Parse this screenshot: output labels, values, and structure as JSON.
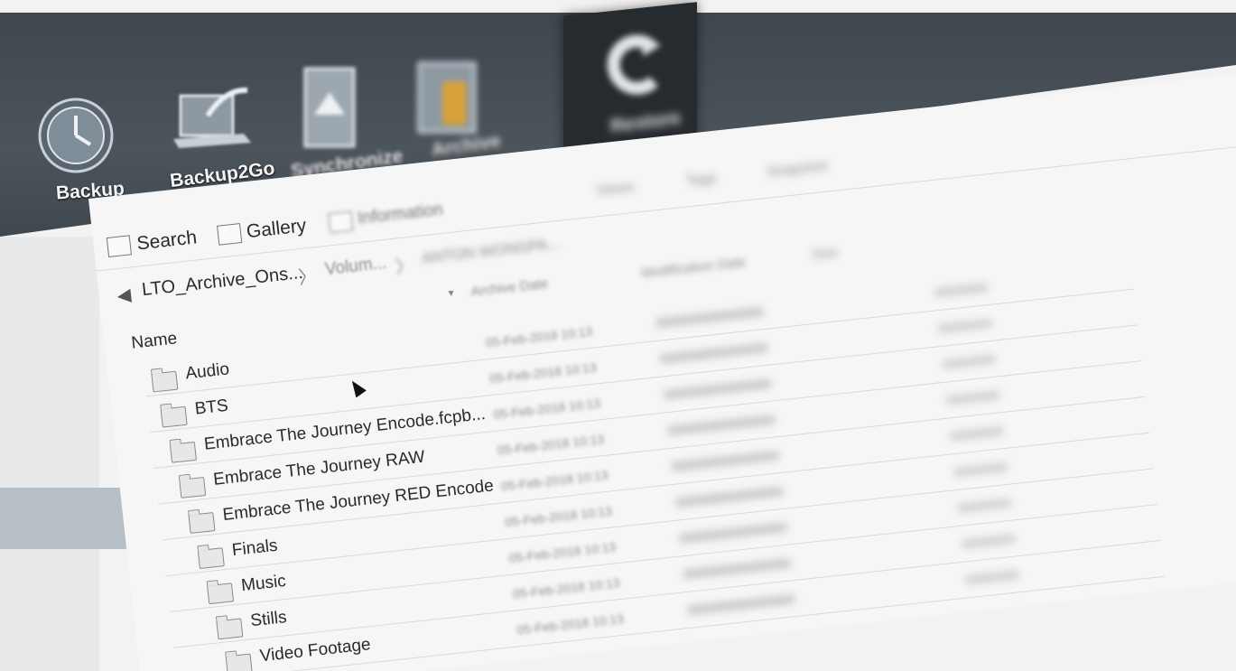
{
  "toolbar": {
    "buttons": [
      {
        "label": "Backup",
        "icon": "clock-icon"
      },
      {
        "label": "Backup2Go",
        "icon": "laptop-icon"
      },
      {
        "label": "Synchronize",
        "icon": "sync-icon"
      },
      {
        "label": "Archive",
        "icon": "archive-box-icon"
      },
      {
        "label": "Restore",
        "icon": "restore-arrow-icon"
      }
    ]
  },
  "tabs": [
    {
      "label": "Search",
      "icon": "search-icon"
    },
    {
      "label": "Gallery",
      "icon": "gallery-icon"
    },
    {
      "label": "Information",
      "icon": "information-icon"
    }
  ],
  "breadcrumb": {
    "items": [
      "LTO_Archive_Ons...",
      "Volum...",
      "ANTON WONGPA..."
    ]
  },
  "columns": {
    "name": "Name",
    "archive_date": "Archive Date",
    "modification_date": "Modification Date",
    "size": "Size"
  },
  "files": [
    {
      "name": "Audio",
      "archive_date": "05-Feb-2018 10:13"
    },
    {
      "name": "BTS",
      "archive_date": "05-Feb-2018 10:13"
    },
    {
      "name": "Embrace The Journey Encode.fcpb...",
      "archive_date": "05-Feb-2018 10:13"
    },
    {
      "name": "Embrace The Journey RAW",
      "archive_date": "05-Feb-2018 10:13"
    },
    {
      "name": "Embrace The Journey RED Encode",
      "archive_date": "05-Feb-2018 10:13"
    },
    {
      "name": "Finals",
      "archive_date": "05-Feb-2018 10:13"
    },
    {
      "name": "Music",
      "archive_date": "05-Feb-2018 10:13"
    },
    {
      "name": "Stills",
      "archive_date": "05-Feb-2018 10:13"
    },
    {
      "name": "Video Footage",
      "archive_date": "05-Feb-2018 10:13"
    }
  ],
  "colors": {
    "toolbar": "#444b52",
    "restore_active": "#262b30",
    "sidebar_selection": "#b6bec6"
  }
}
